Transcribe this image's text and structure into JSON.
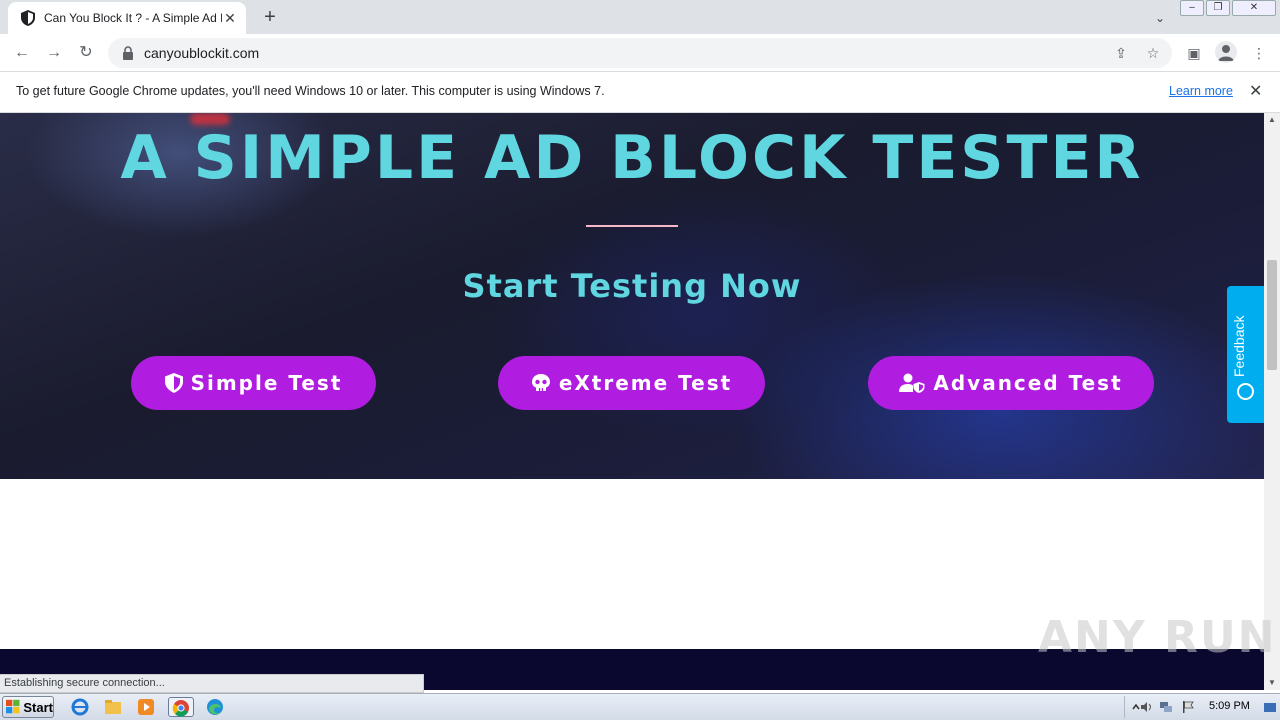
{
  "browser": {
    "tab_title": "Can You Block It ? - A Simple Ad Bloc",
    "new_tab_label": "+",
    "url": "canyoublockit.com"
  },
  "infobar": {
    "message": "To get future Google Chrome updates, you'll need Windows 10 or later. This computer is using Windows 7.",
    "learn_more": "Learn more"
  },
  "hero": {
    "title": "A SIMPLE AD BLOCK TESTER",
    "subtitle": "Start Testing Now",
    "buttons": [
      {
        "label": "Simple Test",
        "icon": "shield-icon"
      },
      {
        "label": "eXtreme Test",
        "icon": "skull-icon"
      },
      {
        "label": "Advanced Test",
        "icon": "user-shield-icon"
      }
    ]
  },
  "feedback": {
    "label": "Feedback"
  },
  "status": {
    "text": "Establishing secure connection..."
  },
  "watermark": {
    "text": "ANY RUN"
  },
  "taskbar": {
    "start_label": "Start",
    "clock": "5:09 PM"
  },
  "colors": {
    "accent_cyan": "#5fd6e0",
    "button_purple": "#b01ce0",
    "feedback_blue": "#00aef0",
    "divider_pink": "#f5b8c6"
  }
}
